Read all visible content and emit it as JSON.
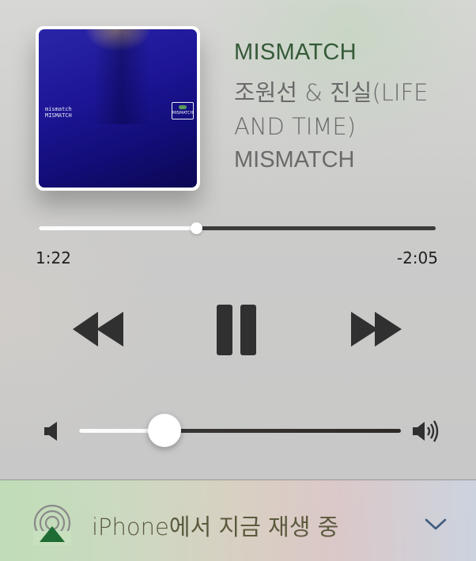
{
  "now_playing": {
    "title": "MISMATCH",
    "artist": "조원선 & 진실(LIFE AND TIME)",
    "album": "MISMATCH",
    "album_art": {
      "text_line1": "mismatch",
      "text_line2": "MISMATCH",
      "logo_text": "MISMATCH"
    }
  },
  "progress": {
    "elapsed": "1:22",
    "remaining": "-2:05",
    "fraction": 0.397
  },
  "controls": {
    "rewind_icon": "rewind-icon",
    "pause_icon": "pause-icon",
    "forward_icon": "fast-forward-icon"
  },
  "volume": {
    "level": 0.265,
    "low_icon": "speaker-low-icon",
    "high_icon": "speaker-high-icon"
  },
  "airplay": {
    "label": "iPhone에서 지금 재생 중",
    "icon": "airplay-icon",
    "chevron_icon": "chevron-down-icon",
    "accent_color": "#1f6b34"
  },
  "colors": {
    "title": "#355a38",
    "secondary_text": "#6a6a6a",
    "track": "#3b3b3b",
    "track_fill": "#fbfbfb"
  }
}
